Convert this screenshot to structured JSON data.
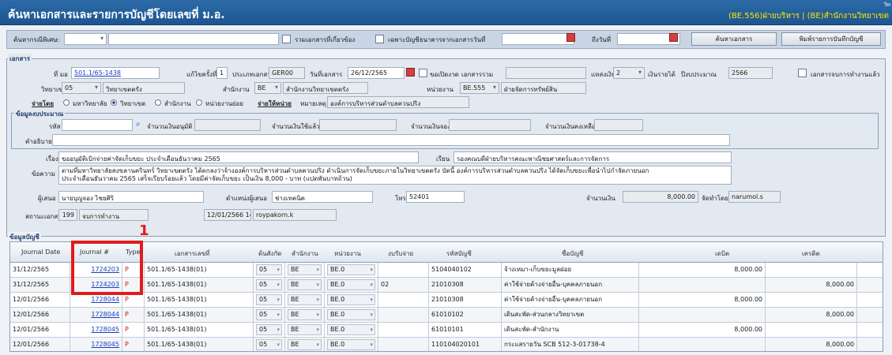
{
  "window": {
    "title": "ค้นหาเอกสารและรายการบัญชีโดยเลขที่ ม.อ.",
    "org_label": "(BE.556)ฝ่ายบริหาร | (BE)สำนักงานวิทยาเขต",
    "corner": "วิท"
  },
  "searchbar": {
    "search_by_label": "ค้นหากรณีพิเศษ:",
    "related_docs_label": "รวมเอกสารที่เกี่ยวข้อง",
    "bank_only_label": "เฉพาะบัญชีธนาคาร",
    "from_date_label": "จากเอกสารวันที่",
    "to_date_label": "ถึงวันที่",
    "search_button": "ค้นหาเอกสาร",
    "print_button": "พิมพ์รายการบันทึกบัญชี"
  },
  "document": {
    "group_label": "เอกสาร",
    "doc_no_label": "ที่ มอ",
    "doc_no": "501.1/65-1438",
    "revision_label": "แก้ไขครั้งที่",
    "revision": "1",
    "doc_type_label": "ประเภทเอกสาร",
    "doc_type": "GER00",
    "doc_date_label": "วันที่เอกสาร",
    "doc_date": "26/12/2565",
    "open_request_label": "ขอเปิดงวด",
    "attached_label": "เอกสารรวม",
    "fund_source_label": "แหล่งเงิน",
    "fund_source": "2",
    "fund_source_name": "เงินรายได้",
    "fiscal_year_label": "ปีงบประมาณ",
    "fiscal_year": "2566",
    "process_doc_label": "เอกสารจบการทำงานแล้ว",
    "campus_label": "วิทยาเขต",
    "campus_code": "05",
    "campus_name": "วิทยาเขตตรัง",
    "office_label": "สำนักงาน",
    "office_code": "BE",
    "office_name": "สำนักงานวิทยาเขตตรัง",
    "unit_label": "หน่วยงาน",
    "unit_code": "BE.555",
    "unit_name": "ฝ่ายจัดการทรัพย์สิน",
    "payer_label": "จ่ายโดย",
    "payer_options": [
      "มหาวิทยาลัย",
      "วิทยาเขต",
      "สำนักงาน",
      "หน่วยงานย่อย"
    ],
    "payer_selected": 1,
    "payee_label": "จ่ายให้หน่วย",
    "payee_note_label": "หมายเหตุ",
    "payee_note": "องค์การบริหารส่วนตำบลควนปริง"
  },
  "budget": {
    "group_label": "ข้อมูลงบประมาณ",
    "code_label": "รหัส",
    "allocated_label": "จำนวนเงินอนุมัติ",
    "used_label": "จำนวนเงินใช้แล้ว",
    "reserved_label": "จำนวนเงินจอง",
    "remaining_label": "จำนวนเงินคงเหลือ",
    "description_label": "คำอธิบาย"
  },
  "detail": {
    "subject_label": "เรื่อง",
    "subject": "ขออนุมัติเบิกจ่ายค่าจัดเก็บขยะ ประจำเดือนธันวาคม 2565",
    "to_label": "เรียน",
    "to": "รองคณบดีฝ่ายบริหารคณะพาณิชยศาสตร์และการจัดการ",
    "body_label": "ข้อความ",
    "body_line1": "ตามที่มหาวิทยาลัยสงขลานครินทร์ วิทยาเขตตรัง ได้ตกลงว่าจ้างองค์การบริหารส่วนตำบลควนปริง ดำเนินการจัดเก็บขยะภายในวิทยาเขตตรัง บัดนี้ องค์การบริหารส่วนตำบลควนปริง ได้จัดเก็บขยะเพื่อนำไปกำจัดภายนอก",
    "body_line2": "ประจำเดือนธันวาคม 2565 เสร็จเรียบร้อยแล้ว โดยมีค่าจัดเก็บขยะ เป็นเงิน 8,000 - บาท (แปดพันบาทถ้วน)",
    "proposer_label": "ผู้เสนอ",
    "proposer": "นายบุญจอง ไชยศิริ",
    "position_label": "ตำแหน่งผู้เสนอ",
    "position": "ช่างเทคนิค",
    "phone_label": "โทร",
    "phone": "52401",
    "amount_label": "จำนวนเงิน",
    "amount": "8,000.00",
    "made_by_label": "จัดทำโดย",
    "made_by": "narumol.s",
    "status_label": "สถานะเอกสาร",
    "status_code": "199",
    "status_name": "จบการทำงาน",
    "status_time": "12/01/2566 14:",
    "status_user": "roypakorn.k"
  },
  "ledger": {
    "group_label": "ข้อมูลบัญชี",
    "columns": [
      "Journal Date",
      "Journal #",
      "Type",
      "เอกสารเลขที่",
      "ต้นสังกัด",
      "สำนักงาน",
      "หน่วยงาน",
      "งบรับจ่าย",
      "รหัสบัญชี",
      "ชื่อบัญชี",
      "เดบิต",
      "เครดิต"
    ],
    "rows": [
      {
        "date": "31/12/2565",
        "journal": "1724203",
        "type": "P",
        "doc": "501.1/65-1438(01)",
        "campus": "05",
        "office": "BE",
        "unit": "BE.0",
        "budget": "",
        "account": "5104040102",
        "name": "จ้างเหมา-เก็บขยะมูลฝอย",
        "debit": "8,000.00",
        "credit": ""
      },
      {
        "date": "31/12/2565",
        "journal": "1724203",
        "type": "P",
        "doc": "501.1/65-1438(01)",
        "campus": "05",
        "office": "BE",
        "unit": "BE.0",
        "budget": "02",
        "account": "21010308",
        "name": "ค่าใช้จ่ายค้างจ่ายอื่น-บุคคลภายนอก",
        "debit": "",
        "credit": "8,000.00"
      },
      {
        "date": "12/01/2566",
        "journal": "1728044",
        "type": "P",
        "doc": "501.1/65-1438(01)",
        "campus": "05",
        "office": "BE",
        "unit": "BE.0",
        "budget": "",
        "account": "21010308",
        "name": "ค่าใช้จ่ายค้างจ่ายอื่น-บุคคลภายนอก",
        "debit": "8,000.00",
        "credit": ""
      },
      {
        "date": "12/01/2566",
        "journal": "1728044",
        "type": "P",
        "doc": "501.1/65-1438(01)",
        "campus": "05",
        "office": "BE",
        "unit": "BE.0",
        "budget": "",
        "account": "61010102",
        "name": "เดินสะพัด-ส่วนกลางวิทยาเขต",
        "debit": "",
        "credit": "8,000.00"
      },
      {
        "date": "12/01/2566",
        "journal": "1728045",
        "type": "P",
        "doc": "501.1/65-1438(01)",
        "campus": "05",
        "office": "BE",
        "unit": "BE.0",
        "budget": "",
        "account": "61010101",
        "name": "เดินสะพัด-สำนักงาน",
        "debit": "8,000.00",
        "credit": ""
      },
      {
        "date": "12/01/2566",
        "journal": "1728045",
        "type": "P",
        "doc": "501.1/65-1438(01)",
        "campus": "05",
        "office": "BE",
        "unit": "BE.0",
        "budget": "",
        "account": "110104020101",
        "name": "กระแสรายวัน SCB 512-3-01738-4",
        "debit": "",
        "credit": "8,000.00"
      }
    ]
  },
  "annotation": {
    "marker": "1"
  }
}
